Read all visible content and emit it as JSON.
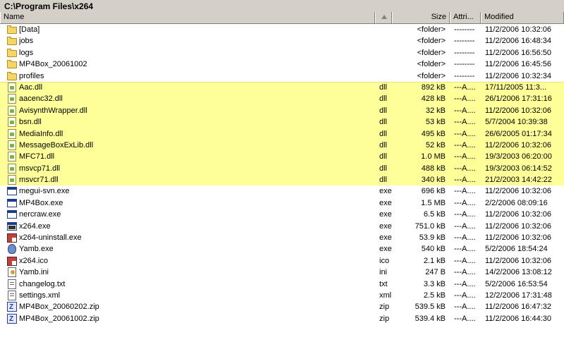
{
  "path": "C:\\Program Files\\x264",
  "columns": {
    "name": "Name",
    "size": "Size",
    "attributes": "Attri...",
    "modified": "Modified"
  },
  "files": [
    {
      "name": "[Data]",
      "ext": "",
      "size": "<folder>",
      "attr": "--------",
      "modified": "11/2/2006 10:32:06",
      "icon": "folder-icon",
      "hl": false
    },
    {
      "name": "jobs",
      "ext": "",
      "size": "<folder>",
      "attr": "--------",
      "modified": "11/2/2006 16:48:34",
      "icon": "folder-icon",
      "hl": false
    },
    {
      "name": "logs",
      "ext": "",
      "size": "<folder>",
      "attr": "--------",
      "modified": "11/2/2006 16:56:50",
      "icon": "folder-icon",
      "hl": false
    },
    {
      "name": "MP4Box_20061002",
      "ext": "",
      "size": "<folder>",
      "attr": "--------",
      "modified": "11/2/2006 16:45:56",
      "icon": "folder-icon",
      "hl": false
    },
    {
      "name": "profiles",
      "ext": "",
      "size": "<folder>",
      "attr": "--------",
      "modified": "11/2/2006 10:32:34",
      "icon": "folder-icon",
      "hl": false
    },
    {
      "name": "Aac.dll",
      "ext": "dll",
      "size": "892 kB",
      "attr": "---A....",
      "modified": "17/11/2005 11:3...",
      "icon": "dll-icon",
      "hl": true
    },
    {
      "name": "aacenc32.dll",
      "ext": "dll",
      "size": "428 kB",
      "attr": "---A....",
      "modified": "26/1/2006 17:31:16",
      "icon": "dll-icon",
      "hl": true
    },
    {
      "name": "AvisynthWrapper.dll",
      "ext": "dll",
      "size": "32 kB",
      "attr": "---A....",
      "modified": "11/2/2006 10:32:06",
      "icon": "dll-icon",
      "hl": true
    },
    {
      "name": "bsn.dll",
      "ext": "dll",
      "size": "53 kB",
      "attr": "---A....",
      "modified": "5/7/2004 10:39:38",
      "icon": "dll-icon",
      "hl": true
    },
    {
      "name": "MediaInfo.dll",
      "ext": "dll",
      "size": "495 kB",
      "attr": "---A....",
      "modified": "26/6/2005 01:17:34",
      "icon": "dll-icon",
      "hl": true
    },
    {
      "name": "MessageBoxExLib.dll",
      "ext": "dll",
      "size": "52 kB",
      "attr": "---A....",
      "modified": "11/2/2006 10:32:06",
      "icon": "dll-icon",
      "hl": true
    },
    {
      "name": "MFC71.dll",
      "ext": "dll",
      "size": "1.0 MB",
      "attr": "---A....",
      "modified": "19/3/2003 06:20:00",
      "icon": "dll-icon",
      "hl": true
    },
    {
      "name": "msvcp71.dll",
      "ext": "dll",
      "size": "488 kB",
      "attr": "---A....",
      "modified": "19/3/2003 06:14:52",
      "icon": "dll-icon",
      "hl": true
    },
    {
      "name": "msvcr71.dll",
      "ext": "dll",
      "size": "340 kB",
      "attr": "---A....",
      "modified": "21/2/2003 14:42:22",
      "icon": "dll-icon",
      "hl": true
    },
    {
      "name": "megui-svn.exe",
      "ext": "exe",
      "size": "696 kB",
      "attr": "---A....",
      "modified": "11/2/2006 10:32:06",
      "icon": "exe-icon",
      "hl": false
    },
    {
      "name": "MP4Box.exe",
      "ext": "exe",
      "size": "1.5 MB",
      "attr": "---A....",
      "modified": "2/2/2006 08:09:16",
      "icon": "exe-icon",
      "hl": false
    },
    {
      "name": "nercraw.exe",
      "ext": "exe",
      "size": "6.5 kB",
      "attr": "---A....",
      "modified": "11/2/2006 10:32:06",
      "icon": "exe-icon",
      "hl": false
    },
    {
      "name": "x264.exe",
      "ext": "exe",
      "size": "751.0 kB",
      "attr": "---A....",
      "modified": "11/2/2006 10:32:06",
      "icon": "console-exe-icon",
      "hl": false
    },
    {
      "name": "x264-uninstall.exe",
      "ext": "exe",
      "size": "53.9 kB",
      "attr": "---A....",
      "modified": "11/2/2006 10:32:06",
      "icon": "installer-icon",
      "hl": false
    },
    {
      "name": "Yamb.exe",
      "ext": "exe",
      "size": "540 kB",
      "attr": "---A....",
      "modified": "5/2/2006 18:54:24",
      "icon": "fish-icon",
      "hl": false
    },
    {
      "name": "x264.ico",
      "ext": "ico",
      "size": "2.1 kB",
      "attr": "---A....",
      "modified": "11/2/2006 10:32:06",
      "icon": "image-icon",
      "hl": false
    },
    {
      "name": "Yamb.ini",
      "ext": "ini",
      "size": "247 B",
      "attr": "---A....",
      "modified": "14/2/2006 13:08:12",
      "icon": "settings-file-icon",
      "hl": false
    },
    {
      "name": "changelog.txt",
      "ext": "txt",
      "size": "3.3 kB",
      "attr": "---A....",
      "modified": "5/2/2006 16:53:54",
      "icon": "text-file-icon",
      "hl": false
    },
    {
      "name": "settings.xml",
      "ext": "xml",
      "size": "2.5 kB",
      "attr": "---A....",
      "modified": "12/2/2006 17:31:48",
      "icon": "xml-file-icon",
      "hl": false
    },
    {
      "name": "MP4Box_20060202.zip",
      "ext": "zip",
      "size": "539.5 kB",
      "attr": "---A....",
      "modified": "11/2/2006 16:47:32",
      "icon": "zip-icon",
      "hl": false
    },
    {
      "name": "MP4Box_20061002.zip",
      "ext": "zip",
      "size": "539.4 kB",
      "attr": "---A....",
      "modified": "11/2/2006 16:44:30",
      "icon": "zip-icon",
      "hl": false
    }
  ],
  "colors": {
    "highlight": "#ffff99",
    "chrome": "#d4d0c8"
  }
}
